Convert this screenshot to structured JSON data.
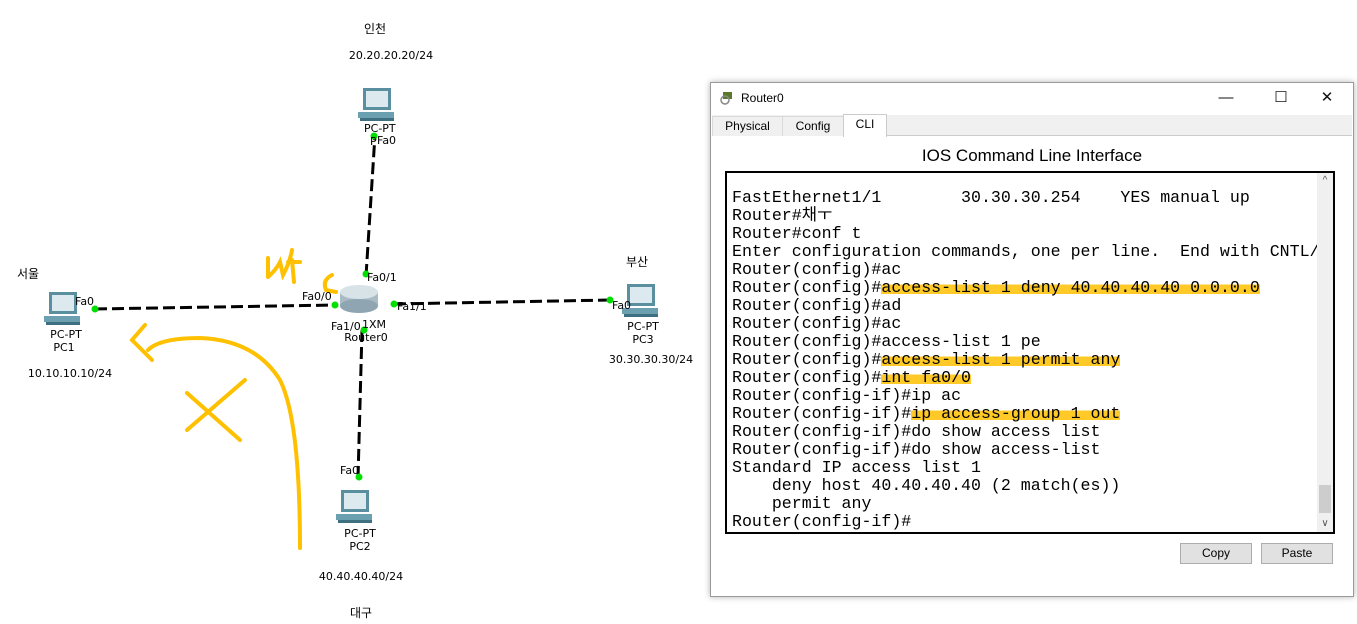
{
  "topology": {
    "regions": {
      "incheon": "인천",
      "seoul": "서울",
      "busan": "부산",
      "daegu": "대구"
    },
    "subnets": {
      "incheon": "20.20.20.20/24",
      "seoul": "10.10.10.10/24",
      "busan": "30.30.30.30/24",
      "daegu": "40.40.40.40/24"
    },
    "pcs": [
      {
        "model": "PC-PT",
        "name": "P",
        "port": "Fa0"
      },
      {
        "model": "PC-PT",
        "name": "PC1",
        "port": "Fa0"
      },
      {
        "model": "PC-PT",
        "name": "PC3",
        "port": "Fa0"
      },
      {
        "model": "PC-PT",
        "name": "PC2",
        "port": "Fa0"
      }
    ],
    "router": {
      "model": "1XM",
      "name": "Router0",
      "ports": [
        "Fa0/0",
        "Fa0/1",
        "Fa1/0",
        "Fa1/1"
      ]
    },
    "annotation_text": "out",
    "link_color": "#000000",
    "port_color": "#00e000",
    "annotation_color": "#ffc000"
  },
  "window": {
    "title": "Router0",
    "tabs": [
      {
        "label": "Physical"
      },
      {
        "label": "Config"
      },
      {
        "label": "CLI",
        "active": true
      }
    ],
    "header": "IOS Command Line Interface",
    "cli_lines": [
      {
        "text": "FastEthernet1/1        30.30.30.254    YES manual up",
        "hl": ""
      },
      {
        "text": "Router#채ㅜ",
        "hl": ""
      },
      {
        "text": "Router#conf t",
        "hl": ""
      },
      {
        "text": "Enter configuration commands, one per line.  End with CNTL/Z.",
        "hl": ""
      },
      {
        "text": "Router(config)#ac",
        "hl": ""
      },
      {
        "text": "Router(config)#",
        "hl": "access-list 1 deny 40.40.40.40 0.0.0.0"
      },
      {
        "text": "Router(config)#ad",
        "hl": ""
      },
      {
        "text": "Router(config)#ac",
        "hl": ""
      },
      {
        "text": "Router(config)#access-list 1 pe",
        "hl": ""
      },
      {
        "text": "Router(config)#",
        "hl": "access-list 1 permit any"
      },
      {
        "text": "Router(config)#",
        "hl": "int fa0/0"
      },
      {
        "text": "Router(config-if)#ip ac",
        "hl": ""
      },
      {
        "text": "Router(config-if)#",
        "hl": "ip access-group 1 out"
      },
      {
        "text": "Router(config-if)#do show access list",
        "hl": ""
      },
      {
        "text": "Router(config-if)#do show access-list",
        "hl": ""
      },
      {
        "text": "Standard IP access list 1",
        "hl": ""
      },
      {
        "text": "    deny host 40.40.40.40 (2 match(es))",
        "hl": ""
      },
      {
        "text": "    permit any",
        "hl": ""
      },
      {
        "text": "Router(config-if)#",
        "hl": ""
      }
    ],
    "copy_label": "Copy",
    "paste_label": "Paste",
    "highlight_color": "#ffc928"
  }
}
